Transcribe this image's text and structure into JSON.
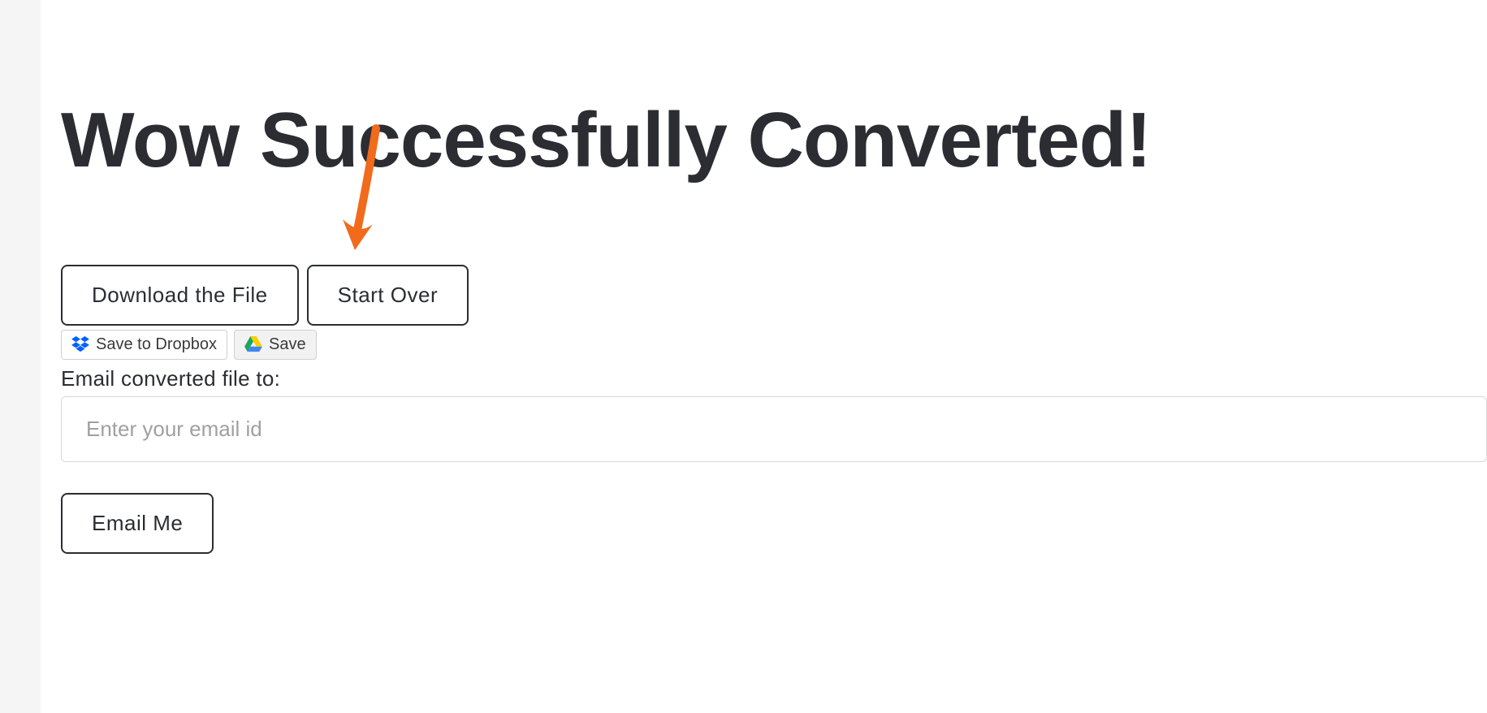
{
  "heading": "Wow Successfully Converted!",
  "buttons": {
    "download": "Download the File",
    "start_over": "Start Over"
  },
  "cloud": {
    "dropbox_label": "Save to Dropbox",
    "gdrive_label": "Save"
  },
  "email": {
    "label": "Email converted file to:",
    "placeholder": "Enter your email id",
    "submit": "Email Me"
  },
  "colors": {
    "arrow": "#f26a1b",
    "text_dark": "#2b2d33"
  }
}
